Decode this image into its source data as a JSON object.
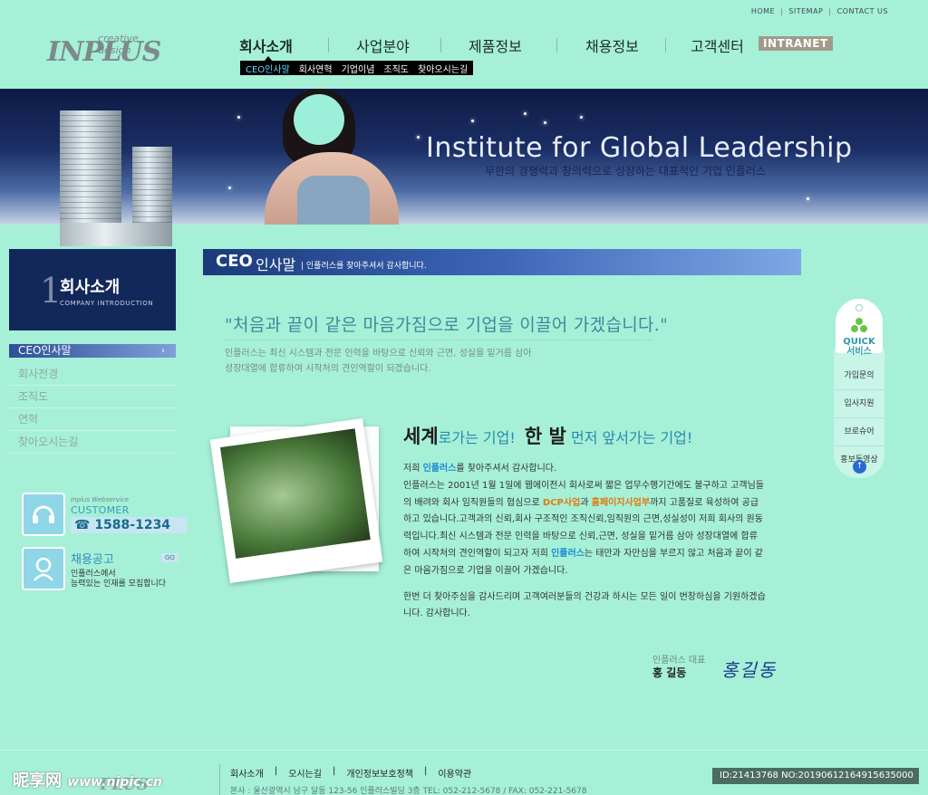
{
  "utility_links": [
    "HOME",
    "SITEMAP",
    "CONTACT US"
  ],
  "logo": {
    "main": "INPLUS",
    "sub": "creative design"
  },
  "nav": {
    "items": [
      "회사소개",
      "사업분야",
      "제품정보",
      "채용정보",
      "고객센터"
    ],
    "intranet": "INTRANET"
  },
  "subnav": [
    "CEO인사말",
    "회사연혁",
    "기업이념",
    "조직도",
    "찾아오시는길"
  ],
  "banner": {
    "title": "Institute for Global Leadership",
    "subtitle": "무한의 경쟁력과 창의력으로 성장하는 대표적인 기업 인플러스"
  },
  "sidebar": {
    "num": "1",
    "title": "회사소개",
    "subtitle_en": "COMPANY INTRODUCTION",
    "items": [
      {
        "label": "CEO인사말",
        "arrow": "›"
      },
      {
        "label": "회사전경"
      },
      {
        "label": "조직도"
      },
      {
        "label": "연혁"
      },
      {
        "label": "찾아오시는길"
      }
    ]
  },
  "customer_center": {
    "en": "Inplus Webservice",
    "title": "CUSTOMER CENTER",
    "tel": "☎ 1588-1234"
  },
  "recruit": {
    "title": "채용공고",
    "more": "GO",
    "desc_line1": "인플러스에서",
    "desc_line2": "능력있는 인재를 모집합니다"
  },
  "content": {
    "header_a": "CEO",
    "header_b": "인사말",
    "header_c": "| 인플러스를 찾아주셔서 감사합니다.",
    "quote": "\"처음과 끝이 같은 마음가짐으로 기업을 이끌어 가겠습니다.\"",
    "intro_line1": "인플러스는 최신 시스템과 전문 인력을 바탕으로 신뢰와 근면, 성실을 밑거름 삼아",
    "intro_line2": "성장대열에 합류하여 시작처의 견인역할이 되겠습니다.",
    "h2_a": "세계",
    "h2_b": "로가는 기업!",
    "h2_c": "한 발",
    "h2_d": "먼저 앞서가는 기업!",
    "p1_a": "저희 ",
    "p1_hl": "인플러스",
    "p1_b": "를 찾아주셔서 감사합니다.",
    "p2_a": "인플러스는 2001년 1월 1일에 웹에이전시 회사로써 짧은 업무수행기간에도 불구하고 고객님들의 배려와 회사 임직원들의 협심으로 ",
    "p2_hl1": "DCP사업",
    "p2_b": "과 ",
    "p2_hl2": "홈페이지사업부",
    "p2_c": "까지 고품질로 육성하여 공급하고 있습니다.고객과의 신뢰,회사 구조적인 조직신뢰,임직원의 근면,성실성이 저희 회사의 원동력입니다.최신 시스템과 전문 인력을 바탕으로 신뢰,근면, 성실을 밑거름 삼아 성장대열에 합류하여 시작처의 견인역할이 되고자 저희 ",
    "p2_hl3": "인플러스",
    "p2_d": "는 태만과 자만심을 부르지 않고 처음과 끝이 같은 마음가짐으로 기업을 이끌어 가겠습니다.",
    "p3": "한번 더 찾아주심을 감사드리며 고객여러분들의 건강과 하시는 모든 일이 번창하심을 기원하겠습니다. 감사합니다.",
    "sign_title": "인플러스 대표",
    "sign_name": "홍 길동",
    "signature": "홍길동"
  },
  "quick": {
    "label_a": "QUICK",
    "label_b": "서비스",
    "items": [
      "가입문의",
      "입사지원",
      "브로슈어",
      "홍보동영상"
    ],
    "up": "↑"
  },
  "footer": {
    "links": [
      "회사소개",
      "|",
      "오시는길",
      "|",
      "개인정보보호정책",
      "|",
      "이용약관"
    ],
    "address": "본사 : 울산광역시 남구 달동 123-56 인플러스빌딩 3층   TEL: 052-212-5678  /  FAX: 052-221-5678",
    "logo": "PLUS"
  },
  "watermark": {
    "cn": "昵享网",
    "url": "www.nipic.cn",
    "id": "ID:21413768 NO:20190612164915635000"
  },
  "colors": {
    "bg": "#a6f0d8",
    "navy": "#13285a",
    "accent": "#2a8aaa",
    "orange": "#e07a10"
  }
}
